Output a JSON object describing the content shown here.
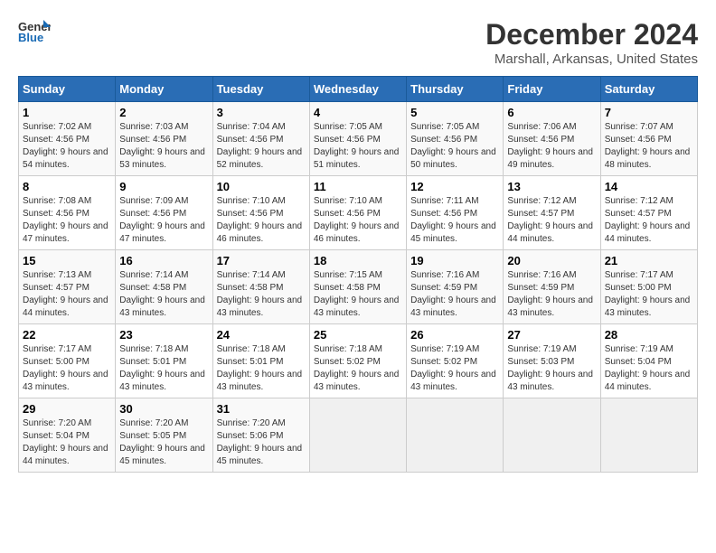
{
  "header": {
    "logo_line1": "General",
    "logo_line2": "Blue",
    "month_title": "December 2024",
    "location": "Marshall, Arkansas, United States"
  },
  "weekdays": [
    "Sunday",
    "Monday",
    "Tuesday",
    "Wednesday",
    "Thursday",
    "Friday",
    "Saturday"
  ],
  "weeks": [
    [
      {
        "day": "1",
        "sunrise": "7:02 AM",
        "sunset": "4:56 PM",
        "daylight": "9 hours and 54 minutes."
      },
      {
        "day": "2",
        "sunrise": "7:03 AM",
        "sunset": "4:56 PM",
        "daylight": "9 hours and 53 minutes."
      },
      {
        "day": "3",
        "sunrise": "7:04 AM",
        "sunset": "4:56 PM",
        "daylight": "9 hours and 52 minutes."
      },
      {
        "day": "4",
        "sunrise": "7:05 AM",
        "sunset": "4:56 PM",
        "daylight": "9 hours and 51 minutes."
      },
      {
        "day": "5",
        "sunrise": "7:05 AM",
        "sunset": "4:56 PM",
        "daylight": "9 hours and 50 minutes."
      },
      {
        "day": "6",
        "sunrise": "7:06 AM",
        "sunset": "4:56 PM",
        "daylight": "9 hours and 49 minutes."
      },
      {
        "day": "7",
        "sunrise": "7:07 AM",
        "sunset": "4:56 PM",
        "daylight": "9 hours and 48 minutes."
      }
    ],
    [
      {
        "day": "8",
        "sunrise": "7:08 AM",
        "sunset": "4:56 PM",
        "daylight": "9 hours and 47 minutes."
      },
      {
        "day": "9",
        "sunrise": "7:09 AM",
        "sunset": "4:56 PM",
        "daylight": "9 hours and 47 minutes."
      },
      {
        "day": "10",
        "sunrise": "7:10 AM",
        "sunset": "4:56 PM",
        "daylight": "9 hours and 46 minutes."
      },
      {
        "day": "11",
        "sunrise": "7:10 AM",
        "sunset": "4:56 PM",
        "daylight": "9 hours and 46 minutes."
      },
      {
        "day": "12",
        "sunrise": "7:11 AM",
        "sunset": "4:56 PM",
        "daylight": "9 hours and 45 minutes."
      },
      {
        "day": "13",
        "sunrise": "7:12 AM",
        "sunset": "4:57 PM",
        "daylight": "9 hours and 44 minutes."
      },
      {
        "day": "14",
        "sunrise": "7:12 AM",
        "sunset": "4:57 PM",
        "daylight": "9 hours and 44 minutes."
      }
    ],
    [
      {
        "day": "15",
        "sunrise": "7:13 AM",
        "sunset": "4:57 PM",
        "daylight": "9 hours and 44 minutes."
      },
      {
        "day": "16",
        "sunrise": "7:14 AM",
        "sunset": "4:58 PM",
        "daylight": "9 hours and 43 minutes."
      },
      {
        "day": "17",
        "sunrise": "7:14 AM",
        "sunset": "4:58 PM",
        "daylight": "9 hours and 43 minutes."
      },
      {
        "day": "18",
        "sunrise": "7:15 AM",
        "sunset": "4:58 PM",
        "daylight": "9 hours and 43 minutes."
      },
      {
        "day": "19",
        "sunrise": "7:16 AM",
        "sunset": "4:59 PM",
        "daylight": "9 hours and 43 minutes."
      },
      {
        "day": "20",
        "sunrise": "7:16 AM",
        "sunset": "4:59 PM",
        "daylight": "9 hours and 43 minutes."
      },
      {
        "day": "21",
        "sunrise": "7:17 AM",
        "sunset": "5:00 PM",
        "daylight": "9 hours and 43 minutes."
      }
    ],
    [
      {
        "day": "22",
        "sunrise": "7:17 AM",
        "sunset": "5:00 PM",
        "daylight": "9 hours and 43 minutes."
      },
      {
        "day": "23",
        "sunrise": "7:18 AM",
        "sunset": "5:01 PM",
        "daylight": "9 hours and 43 minutes."
      },
      {
        "day": "24",
        "sunrise": "7:18 AM",
        "sunset": "5:01 PM",
        "daylight": "9 hours and 43 minutes."
      },
      {
        "day": "25",
        "sunrise": "7:18 AM",
        "sunset": "5:02 PM",
        "daylight": "9 hours and 43 minutes."
      },
      {
        "day": "26",
        "sunrise": "7:19 AM",
        "sunset": "5:02 PM",
        "daylight": "9 hours and 43 minutes."
      },
      {
        "day": "27",
        "sunrise": "7:19 AM",
        "sunset": "5:03 PM",
        "daylight": "9 hours and 43 minutes."
      },
      {
        "day": "28",
        "sunrise": "7:19 AM",
        "sunset": "5:04 PM",
        "daylight": "9 hours and 44 minutes."
      }
    ],
    [
      {
        "day": "29",
        "sunrise": "7:20 AM",
        "sunset": "5:04 PM",
        "daylight": "9 hours and 44 minutes."
      },
      {
        "day": "30",
        "sunrise": "7:20 AM",
        "sunset": "5:05 PM",
        "daylight": "9 hours and 45 minutes."
      },
      {
        "day": "31",
        "sunrise": "7:20 AM",
        "sunset": "5:06 PM",
        "daylight": "9 hours and 45 minutes."
      },
      null,
      null,
      null,
      null
    ]
  ]
}
